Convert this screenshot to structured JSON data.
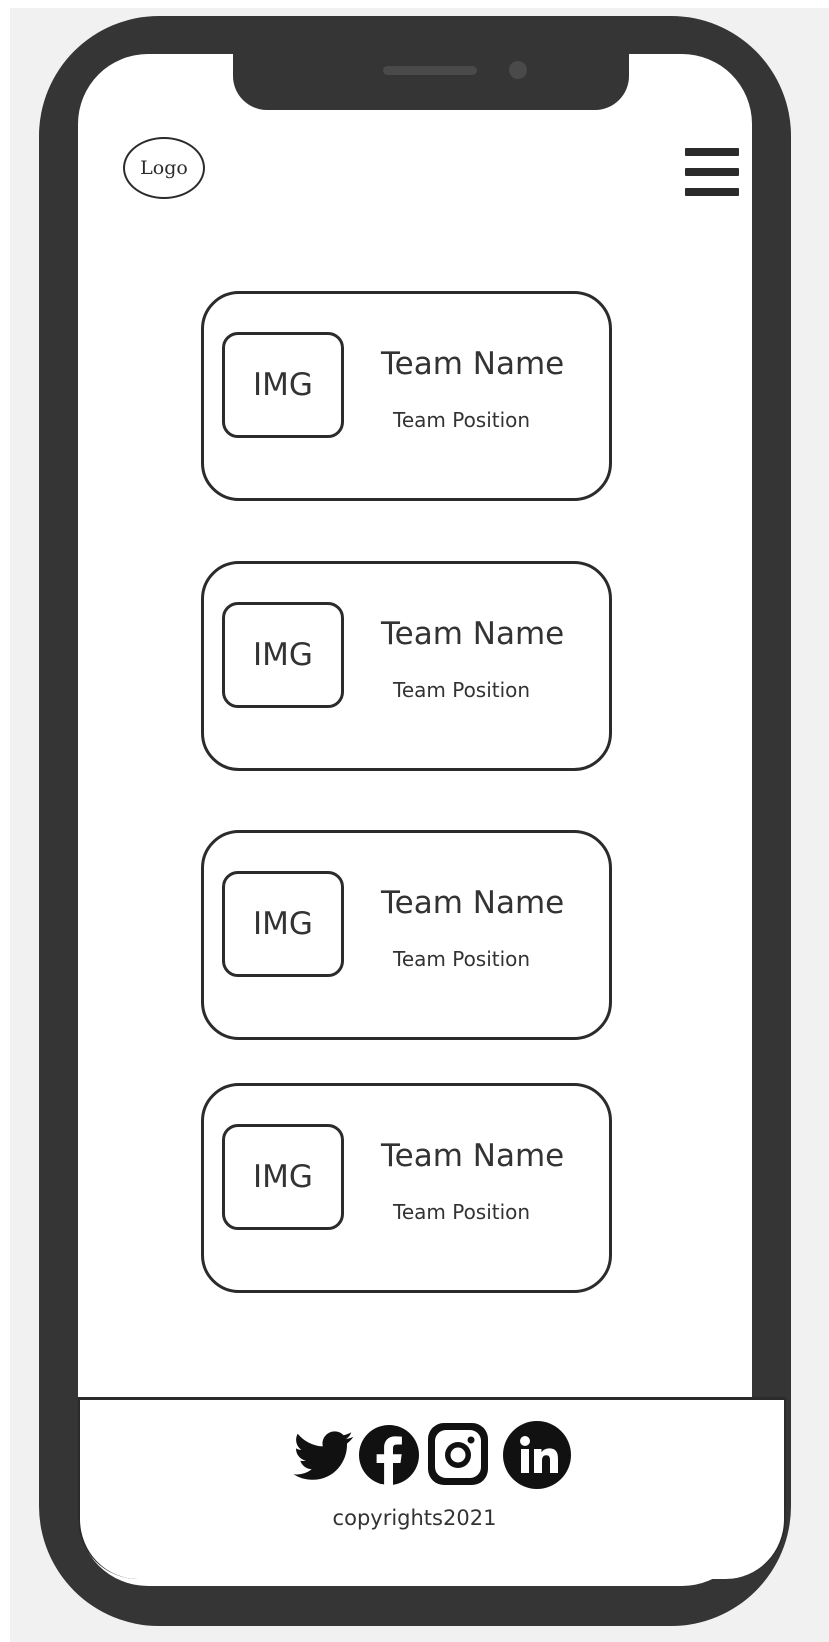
{
  "header": {
    "logo_text": "Logo",
    "menu_icon": "hamburger-menu-icon"
  },
  "team": [
    {
      "image_label": "IMG",
      "name": "Team Name",
      "position": "Team Position"
    },
    {
      "image_label": "IMG",
      "name": "Team Name",
      "position": "Team Position"
    },
    {
      "image_label": "IMG",
      "name": "Team Name",
      "position": "Team Position"
    },
    {
      "image_label": "IMG",
      "name": "Team Name",
      "position": "Team Position"
    }
  ],
  "footer": {
    "social_icons": [
      "twitter-icon",
      "facebook-icon",
      "instagram-icon",
      "linkedin-icon"
    ],
    "copyright": "copyrights2021"
  },
  "colors": {
    "frame": "#353535",
    "ink": "#2b2b2b",
    "background": "#f1f1f1"
  }
}
